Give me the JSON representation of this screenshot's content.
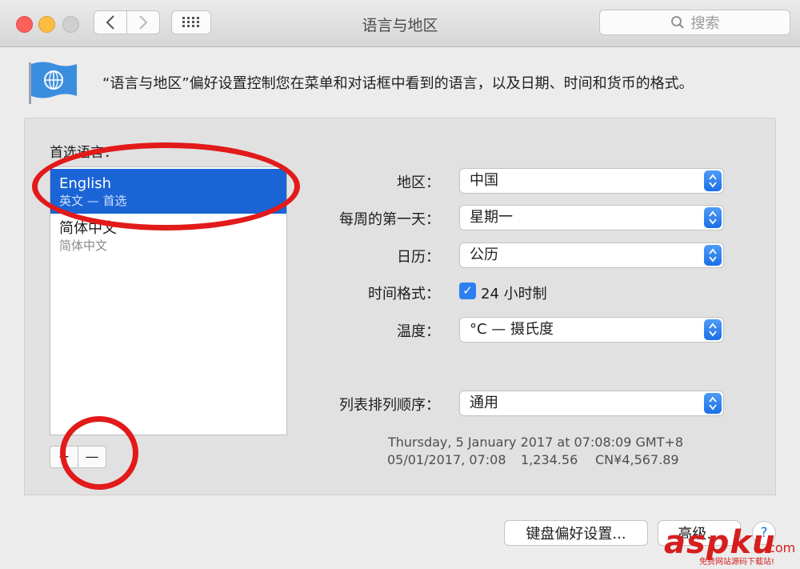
{
  "window": {
    "title": "语言与地区",
    "search_placeholder": "搜索"
  },
  "header": {
    "description": "“语言与地区”偏好设置控制您在菜单和对话框中看到的语言，以及日期、时间和货币的格式。"
  },
  "languages": {
    "label": "首选语言：",
    "items": [
      {
        "name": "English",
        "sub": "英文 — 首选",
        "selected": true
      },
      {
        "name": "简体中文",
        "sub": "简体中文",
        "selected": false
      }
    ],
    "add_label": "+",
    "remove_label": "—"
  },
  "form": {
    "region": {
      "label": "地区：",
      "value": "中国"
    },
    "first_day": {
      "label": "每周的第一天：",
      "value": "星期一"
    },
    "calendar": {
      "label": "日历：",
      "value": "公历"
    },
    "time_format": {
      "label": "时间格式：",
      "value": "24 小时制",
      "checked": true
    },
    "temperature": {
      "label": "温度：",
      "value": "°C — 摄氏度"
    },
    "sort_order": {
      "label": "列表排列顺序：",
      "value": "通用"
    }
  },
  "sample": {
    "line1": "Thursday, 5 January 2017 at 07:08:09 GMT+8",
    "date_short": "05/01/2017, 07:08",
    "number": "1,234.56",
    "currency": "CN¥4,567.89"
  },
  "footer": {
    "keyboard_button": "键盘偏好设置...",
    "advanced_button": "高级...",
    "help_button": "?"
  },
  "watermark": {
    "text": "aspku",
    "suffix": ".com",
    "sub": "免费网站源码下载站!"
  },
  "colors": {
    "selection": "#1a64d6",
    "annotation": "#e21a1a",
    "accent": "#2d7ff0"
  }
}
